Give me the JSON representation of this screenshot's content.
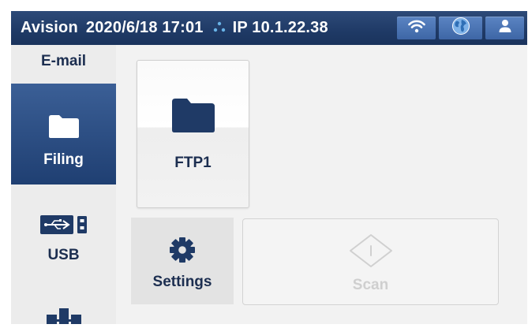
{
  "status_bar": {
    "brand": "Avision",
    "datetime": "2020/6/18 17:01",
    "ip": "IP 10.1.22.38",
    "icons": [
      "network-icon",
      "wifi-icon",
      "globe-icon",
      "user-icon"
    ]
  },
  "sidebar": {
    "items": [
      {
        "label": "E-mail",
        "selected": false
      },
      {
        "label": "Filing",
        "icon": "folder-icon",
        "selected": true
      },
      {
        "label": "USB",
        "icon": "usb-icon",
        "selected": false
      },
      {
        "label": "",
        "icon": "network-share-icon",
        "selected": false
      }
    ]
  },
  "main": {
    "destinations": [
      {
        "label": "FTP1",
        "icon": "folder-icon"
      }
    ],
    "settings_label": "Settings",
    "scan_label": "Scan",
    "scan_enabled": false
  },
  "colors": {
    "accent": "#1f3a66",
    "selected": "#2f5189",
    "text": "#1c2e50",
    "disabled": "#cfcfcf"
  }
}
